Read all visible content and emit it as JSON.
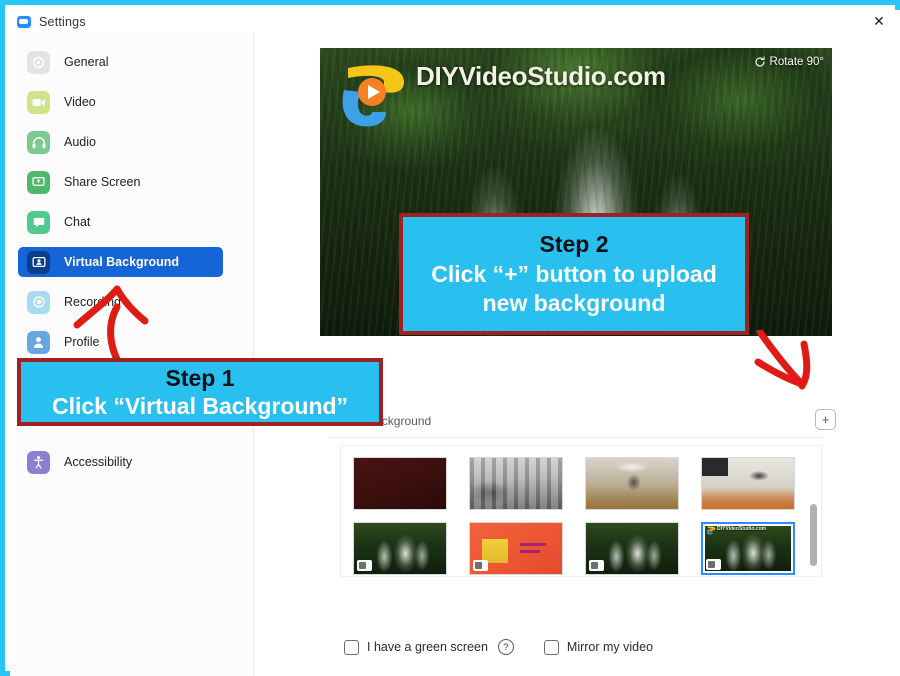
{
  "window": {
    "title": "Settings",
    "app_icon": "zoom-logo-icon",
    "close_label": "✕",
    "frame_color": "#29c5f6"
  },
  "sidebar": {
    "items": [
      {
        "label": "General",
        "icon": "gear-icon",
        "icon_color": "#e3e3e3",
        "selected": false
      },
      {
        "label": "Video",
        "icon": "video-camera-icon",
        "icon_color": "#cfe48a",
        "selected": false
      },
      {
        "label": "Audio",
        "icon": "headphones-icon",
        "icon_color": "#7ec98f",
        "selected": false
      },
      {
        "label": "Share Screen",
        "icon": "share-screen-icon",
        "icon_color": "#4fb96b",
        "selected": false
      },
      {
        "label": "Chat",
        "icon": "chat-bubble-icon",
        "icon_color": "#4fc98c",
        "selected": false
      },
      {
        "label": "Virtual Background",
        "icon": "virtual-background-icon",
        "icon_color": "#0d4fa8",
        "selected": true
      },
      {
        "label": "Recording",
        "icon": "record-icon",
        "icon_color": "#a8dbf2",
        "selected": false
      },
      {
        "label": "Profile",
        "icon": "profile-person-icon",
        "icon_color": "#68a6e0",
        "selected": false
      },
      {
        "label": "Accessibility",
        "icon": "accessibility-icon",
        "icon_color": "#8a7fd0",
        "selected": false
      }
    ],
    "selected_color": "#1565d8"
  },
  "preview": {
    "watermark": "DIYVideoStudio.com",
    "rotate_label": "Rotate 90°",
    "rotate_icon": "rotate-icon",
    "logo_icon": "diy-video-studio-logo-icon",
    "scene_description": "waterfall"
  },
  "virtual_background": {
    "section_label": "Virtual Background",
    "add_button_label": "+",
    "add_button_icon": "plus-icon",
    "thumbnails": [
      {
        "name": "none-dark-red",
        "style": "th-none",
        "selected": false,
        "has_video_badge": false,
        "watermark": ""
      },
      {
        "name": "office-bw",
        "style": "th-office",
        "selected": false,
        "has_video_badge": false,
        "watermark": ""
      },
      {
        "name": "empty-hall",
        "style": "th-hall",
        "selected": false,
        "has_video_badge": false,
        "watermark": ""
      },
      {
        "name": "lounge-room",
        "style": "th-lounge",
        "selected": false,
        "has_video_badge": false,
        "watermark": ""
      },
      {
        "name": "waterfall-1",
        "style": "th-falls",
        "selected": false,
        "has_video_badge": true,
        "watermark": ""
      },
      {
        "name": "orange-sign",
        "style": "th-sign",
        "selected": false,
        "has_video_badge": true,
        "watermark": ""
      },
      {
        "name": "waterfall-2",
        "style": "th-falls",
        "selected": false,
        "has_video_badge": true,
        "watermark": ""
      },
      {
        "name": "waterfall-diy",
        "style": "th-falls",
        "selected": true,
        "has_video_badge": true,
        "watermark": "DIYVideoStudio.com"
      }
    ],
    "scrollbar": {
      "thumb_position_percent": 45
    }
  },
  "options": {
    "green_screen_label": "I have a green screen",
    "green_screen_checked": false,
    "help_icon_label": "?",
    "mirror_label": "Mirror my video",
    "mirror_checked": false
  },
  "annotations": {
    "callout_color": "#29c0ef",
    "callout_border_color": "#9e2222",
    "arrow_color": "#e01b16",
    "step1": {
      "line1": "Step 1",
      "line2": "Click “Virtual Background”"
    },
    "step2": {
      "line1": "Step 2",
      "line2a": "Click “+” button to upload",
      "line2b": "new background"
    }
  }
}
